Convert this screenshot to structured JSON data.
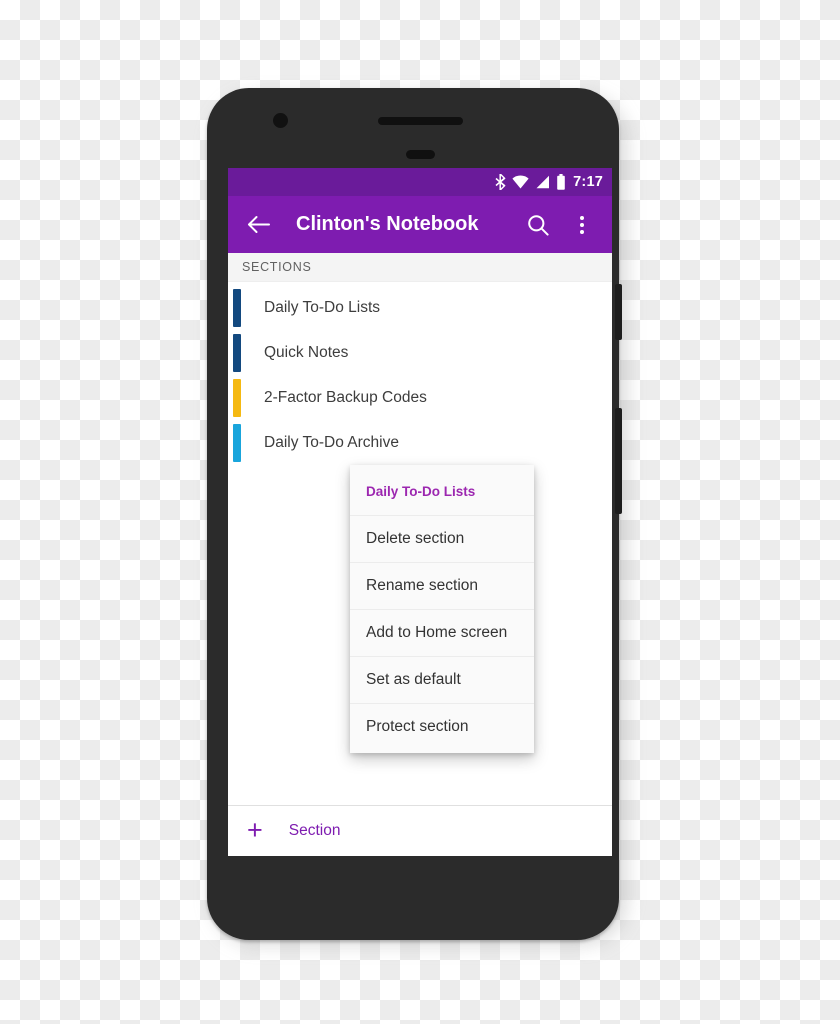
{
  "device": {
    "type": "android-phone-mockup",
    "frame_color": "#2b2b2b"
  },
  "status_bar": {
    "time": "7:17",
    "icons": [
      "bluetooth-icon",
      "wifi-icon",
      "cellular-signal-icon",
      "battery-icon"
    ],
    "background": "#6a1b9a"
  },
  "toolbar": {
    "title": "Clinton's Notebook",
    "back_icon": "arrow-back-icon",
    "search_icon": "search-icon",
    "overflow_icon": "overflow-menu-icon",
    "background": "#7e1cb0",
    "accent": "#7e1cb0"
  },
  "content": {
    "header_label": "SECTIONS",
    "sections": [
      {
        "label": "Daily To-Do Lists",
        "color": "#13497f"
      },
      {
        "label": "Quick Notes",
        "color": "#13497f"
      },
      {
        "label": "2-Factor Backup Codes",
        "color": "#f5b912"
      },
      {
        "label": "Daily To-Do Archive",
        "color": "#19a5dc"
      }
    ]
  },
  "context_menu": {
    "title": "Daily To-Do Lists",
    "title_color": "#9c27b0",
    "items": [
      "Delete section",
      "Rename section",
      "Add to Home screen",
      "Set as default",
      "Protect section"
    ]
  },
  "add_section": {
    "plus_icon": "plus-icon",
    "label": "Section",
    "color": "#7e1cb0"
  },
  "nav_bar": {
    "back": "nav-back-icon",
    "home": "nav-home-icon",
    "recents": "nav-recents-icon"
  }
}
